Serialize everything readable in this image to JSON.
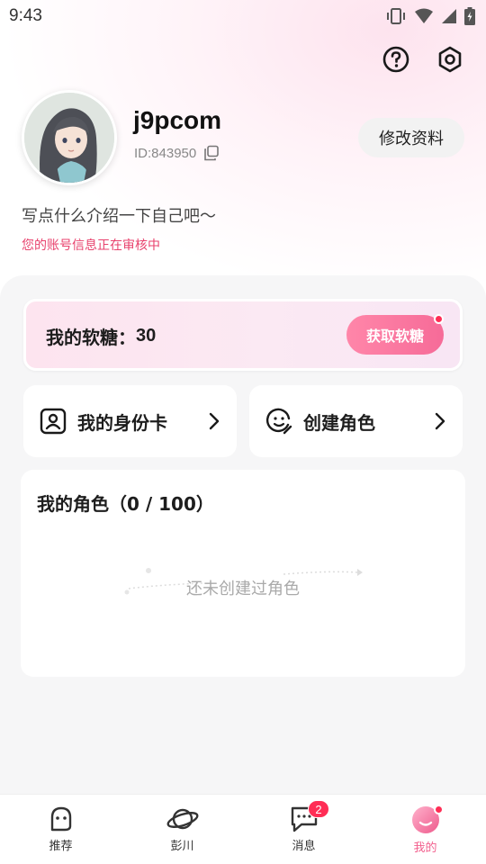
{
  "status_bar": {
    "time": "9:43"
  },
  "profile": {
    "username": "j9pcom",
    "user_id": "ID:843950",
    "edit_label": "修改资料",
    "bio": "写点什么介绍一下自己吧～",
    "review_note": "您的账号信息正在审核中"
  },
  "candy": {
    "label": "我的软糖：",
    "count": "30",
    "get_label": "获取软糖"
  },
  "actions": {
    "identity_card": "我的身份卡",
    "create_role": "创建角色"
  },
  "roles": {
    "title": "我的角色（0 / 100）",
    "empty_text": "还未创建过角色"
  },
  "nav": {
    "items": [
      {
        "label": "推荐",
        "icon": "ghost-icon"
      },
      {
        "label": "彭川",
        "icon": "planet-icon"
      },
      {
        "label": "消息",
        "icon": "message-icon",
        "badge": "2"
      },
      {
        "label": "我的",
        "icon": "profile-face-icon"
      }
    ],
    "active_index": 3
  },
  "colors": {
    "accent": "#f2608e",
    "badge": "#ff2d55",
    "review_text": "#e8426d"
  }
}
